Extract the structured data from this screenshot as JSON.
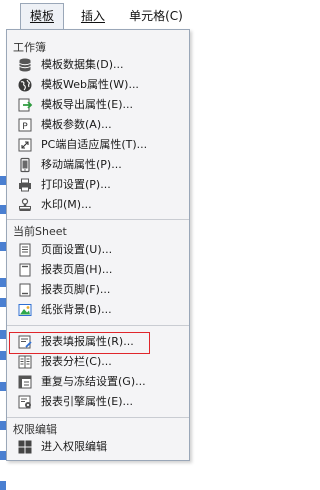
{
  "menubar": {
    "tabs": [
      {
        "label": "模板",
        "active": true
      },
      {
        "label": "插入",
        "active": false
      },
      {
        "label": "单元格(C)",
        "active": false
      }
    ]
  },
  "dropdown": {
    "sections": {
      "workbook": "工作簿",
      "sheet": "当前Sheet",
      "permission": "权限编辑"
    },
    "workbook_items": [
      {
        "label": "模板数据集(D)...",
        "icon": "database-icon"
      },
      {
        "label": "模板Web属性(W)...",
        "icon": "globe-icon"
      },
      {
        "label": "模板导出属性(E)...",
        "icon": "export-icon"
      },
      {
        "label": "模板参数(A)...",
        "icon": "parameter-icon"
      },
      {
        "label": "PC端自适应属性(T)...",
        "icon": "resize-icon"
      },
      {
        "label": "移动端属性(P)...",
        "icon": "mobile-icon"
      },
      {
        "label": "打印设置(P)...",
        "icon": "printer-icon"
      },
      {
        "label": "水印(M)...",
        "icon": "stamp-icon"
      }
    ],
    "sheet_items": [
      {
        "label": "页面设置(U)...",
        "icon": "page-setup-icon"
      },
      {
        "label": "报表页眉(H)...",
        "icon": "header-icon"
      },
      {
        "label": "报表页脚(F)...",
        "icon": "footer-icon"
      },
      {
        "label": "纸张背景(B)...",
        "icon": "image-icon"
      },
      {
        "label": "报表填报属性(R)...",
        "icon": "form-fill-icon"
      },
      {
        "label": "报表分栏(C)...",
        "icon": "columns-icon"
      },
      {
        "label": "重复与冻结设置(G)...",
        "icon": "freeze-icon"
      },
      {
        "label": "报表引擎属性(E)...",
        "icon": "engine-icon"
      }
    ],
    "permission_items": [
      {
        "label": "进入权限编辑",
        "icon": "permission-icon"
      }
    ],
    "highlighted_item": "报表填报属性(R)..."
  },
  "colors": {
    "highlight_border": "#e0262b",
    "icon_blue": "#2f6fd1",
    "icon_dark": "#444444"
  }
}
